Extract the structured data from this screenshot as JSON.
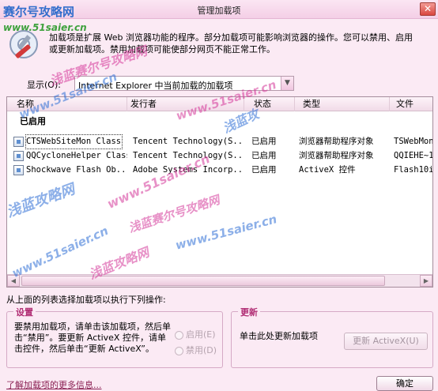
{
  "window": {
    "title": "管理加载项",
    "close_glyph": "✕"
  },
  "intro": "加载项是扩展 Web 浏览器功能的程序。部分加载项可能影响浏览器的操作。您可以禁用、启用或更新加载项。禁用加载项可能使部分网页不能正常工作。",
  "show": {
    "label": "显示(O):",
    "selected": "Internet Explorer 中当前加载的加载项"
  },
  "columns": [
    "名称",
    "发行者",
    "状态",
    "类型",
    "文件"
  ],
  "group_label": "已启用",
  "rows": [
    {
      "name": "CTSWebSiteMon Class",
      "publisher": "Tencent Technology(S...",
      "status": "已启用",
      "type": "浏览器帮助程序对象",
      "file": "TSWebMon..."
    },
    {
      "name": "QQCycloneHelper Class",
      "publisher": "Tencent Technology(S...",
      "status": "已启用",
      "type": "浏览器帮助程序对象",
      "file": "QQIEHE~1..."
    },
    {
      "name": "Shockwave Flash Ob...",
      "publisher": "Adobe Systems Incorp...",
      "status": "已启用",
      "type": "ActiveX 控件",
      "file": "Flash10i..."
    }
  ],
  "instruction": "从上面的列表选择加载项以执行下列操作:",
  "settings": {
    "title": "设置",
    "desc": "要禁用加载项，请单击该加载项，然后单击“禁用”。要更新 ActiveX 控件，请单击控件，然后单击“更新 ActiveX”。",
    "enable": "启用(E)",
    "disable": "禁用(D)"
  },
  "update": {
    "title": "更新",
    "desc": "单击此处更新加载项",
    "button": "更新 ActiveX(U)"
  },
  "more_link": "了解加载项的更多信息...",
  "ok": "确定",
  "watermarks": {
    "logo": "赛尔号攻略网",
    "url": "www.51saier.cn",
    "text1": "浅蓝攻略网",
    "text2": "www.51saier.cn",
    "text3": "浅蓝赛尔号攻略网",
    "text4": "浅蓝攻"
  }
}
